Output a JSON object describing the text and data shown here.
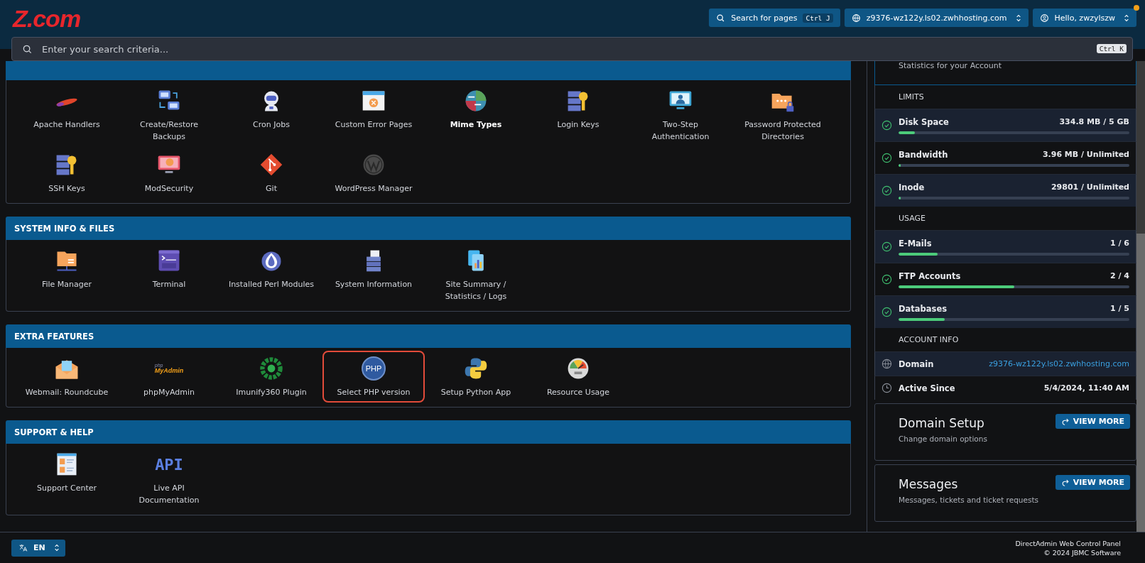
{
  "header": {
    "logo": "Z.com",
    "search_button": {
      "label": "Search for pages",
      "shortcut": "Ctrl J"
    },
    "host_select": {
      "value": "z9376-wz122y.ls02.zwhhosting.com"
    },
    "user_menu": {
      "label": "Hello, zwzylszw",
      "notification": true
    }
  },
  "search": {
    "placeholder": "Enter your search criteria...",
    "shortcut": "Ctrl K"
  },
  "sections": [
    {
      "items": [
        {
          "label": "Apache Handlers",
          "highlighted": false,
          "hovered": false
        },
        {
          "label": "Create/Restore Backups",
          "highlighted": false,
          "hovered": false
        },
        {
          "label": "Cron Jobs",
          "highlighted": false,
          "hovered": false
        },
        {
          "label": "Custom Error Pages",
          "highlighted": false,
          "hovered": false
        },
        {
          "label": "Mime Types",
          "highlighted": false,
          "hovered": true
        },
        {
          "label": "Login Keys",
          "highlighted": false,
          "hovered": false
        },
        {
          "label": "Two-Step Authentication",
          "highlighted": false,
          "hovered": false
        },
        {
          "label": "Password Protected Directories",
          "highlighted": false,
          "hovered": false
        },
        {
          "label": "SSH Keys",
          "highlighted": false,
          "hovered": false
        },
        {
          "label": "ModSecurity",
          "highlighted": false,
          "hovered": false
        },
        {
          "label": "Git",
          "highlighted": false,
          "hovered": false
        },
        {
          "label": "WordPress Manager",
          "highlighted": false,
          "hovered": false
        }
      ]
    },
    {
      "title": "SYSTEM INFO & FILES",
      "items": [
        {
          "label": "File Manager",
          "highlighted": false,
          "hovered": false
        },
        {
          "label": "Terminal",
          "highlighted": false,
          "hovered": false
        },
        {
          "label": "Installed Perl Modules",
          "highlighted": false,
          "hovered": false
        },
        {
          "label": "System Information",
          "highlighted": false,
          "hovered": false
        },
        {
          "label": "Site Summary / Statistics / Logs",
          "highlighted": false,
          "hovered": false
        }
      ]
    },
    {
      "title": "EXTRA FEATURES",
      "items": [
        {
          "label": "Webmail: Roundcube",
          "highlighted": false,
          "hovered": false
        },
        {
          "label": "phpMyAdmin",
          "highlighted": false,
          "hovered": false,
          "icon_text": [
            "php",
            "MyAdmin"
          ]
        },
        {
          "label": "Imunify360 Plugin",
          "highlighted": false,
          "hovered": false
        },
        {
          "label": "Select PHP version",
          "highlighted": true,
          "hovered": false,
          "icon_text": [
            "PHP"
          ]
        },
        {
          "label": "Setup Python App",
          "highlighted": false,
          "hovered": false
        },
        {
          "label": "Resource Usage",
          "highlighted": false,
          "hovered": false
        }
      ]
    },
    {
      "title": "SUPPORT & HELP",
      "items": [
        {
          "label": "Support Center",
          "highlighted": false,
          "hovered": false
        },
        {
          "label": "Live API Documentation",
          "highlighted": false,
          "hovered": false,
          "icon_text": [
            "API"
          ]
        }
      ]
    }
  ],
  "stats": {
    "subtitle": "Statistics for your Account",
    "groups": [
      {
        "title": "LIMITS",
        "rows": [
          {
            "kind": "meter",
            "label": "Disk Space",
            "value": "334.8 MB / 5 GB",
            "level": 0.07,
            "ok": true
          },
          {
            "kind": "meter",
            "label": "Bandwidth",
            "value": "3.96 MB / Unlimited",
            "level": 0.01,
            "ok": true
          },
          {
            "kind": "meter",
            "label": "Inode",
            "value": "29801 / Unlimited",
            "level": 0.01,
            "ok": true
          }
        ]
      },
      {
        "title": "USAGE",
        "rows": [
          {
            "kind": "meter",
            "label": "E-Mails",
            "value": "1 / 6",
            "level": 0.17,
            "ok": true
          },
          {
            "kind": "meter",
            "label": "FTP Accounts",
            "value": "2 / 4",
            "level": 0.5,
            "ok": true
          },
          {
            "kind": "meter",
            "label": "Databases",
            "value": "1 / 5",
            "level": 0.2,
            "ok": true
          }
        ]
      },
      {
        "title": "ACCOUNT INFO",
        "rows": [
          {
            "kind": "domain",
            "label": "Domain",
            "value": "z9376-wz122y.ls02.zwhhosting.com"
          },
          {
            "kind": "date",
            "label": "Active Since",
            "value": "5/4/2024, 11:40 AM"
          }
        ]
      }
    ]
  },
  "cards": [
    {
      "title": "Domain Setup",
      "subtitle": "Change domain options",
      "button": "VIEW MORE"
    },
    {
      "title": "Messages",
      "subtitle": "Messages, tickets and ticket requests",
      "button": "VIEW MORE"
    }
  ],
  "footer": {
    "language": "EN",
    "lines": [
      "DirectAdmin Web Control Panel",
      "© 2024 JBMC Software"
    ]
  }
}
